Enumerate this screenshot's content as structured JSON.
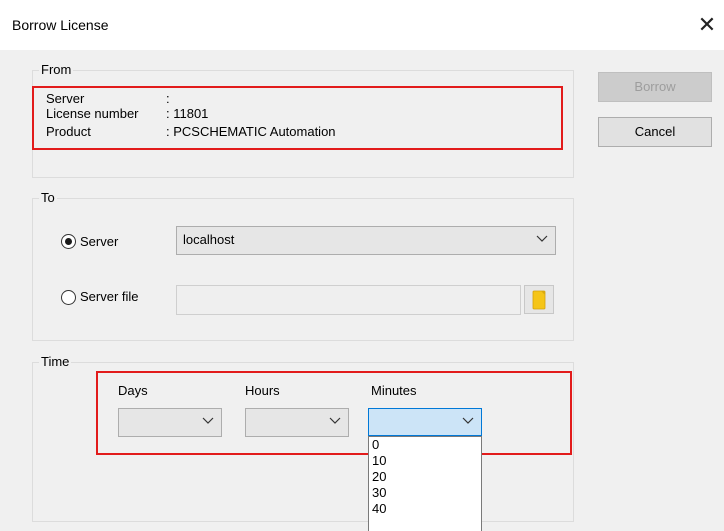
{
  "window": {
    "title": "Borrow License",
    "close_glyph": "✕"
  },
  "from": {
    "legend": "From",
    "rows": [
      {
        "label": "Server",
        "value": ":"
      },
      {
        "label": "License number",
        "value": ": 11801"
      },
      {
        "label": "Product",
        "value": ": PCSCHEMATIC Automation"
      }
    ]
  },
  "buttons": {
    "borrow": "Borrow",
    "cancel": "Cancel"
  },
  "to": {
    "legend": "To",
    "server_radio_label": "Server",
    "server_file_radio_label": "Server file",
    "server_value": "localhost",
    "server_selected": true,
    "server_file_value": ""
  },
  "time": {
    "legend": "Time",
    "days_label": "Days",
    "hours_label": "Hours",
    "minutes_label": "Minutes",
    "days_value": "",
    "hours_value": "",
    "minutes_value": "",
    "minutes_options": [
      "0",
      "10",
      "20",
      "30",
      "40"
    ]
  },
  "colors": {
    "highlight_box": "#e21b1b",
    "focus_border": "#0078d7",
    "focus_fill": "#cce4f7",
    "folder_icon": "#f5c518"
  },
  "icons": {
    "close": "close-icon",
    "chevron": "chevron-down-icon",
    "folder": "folder-icon"
  }
}
